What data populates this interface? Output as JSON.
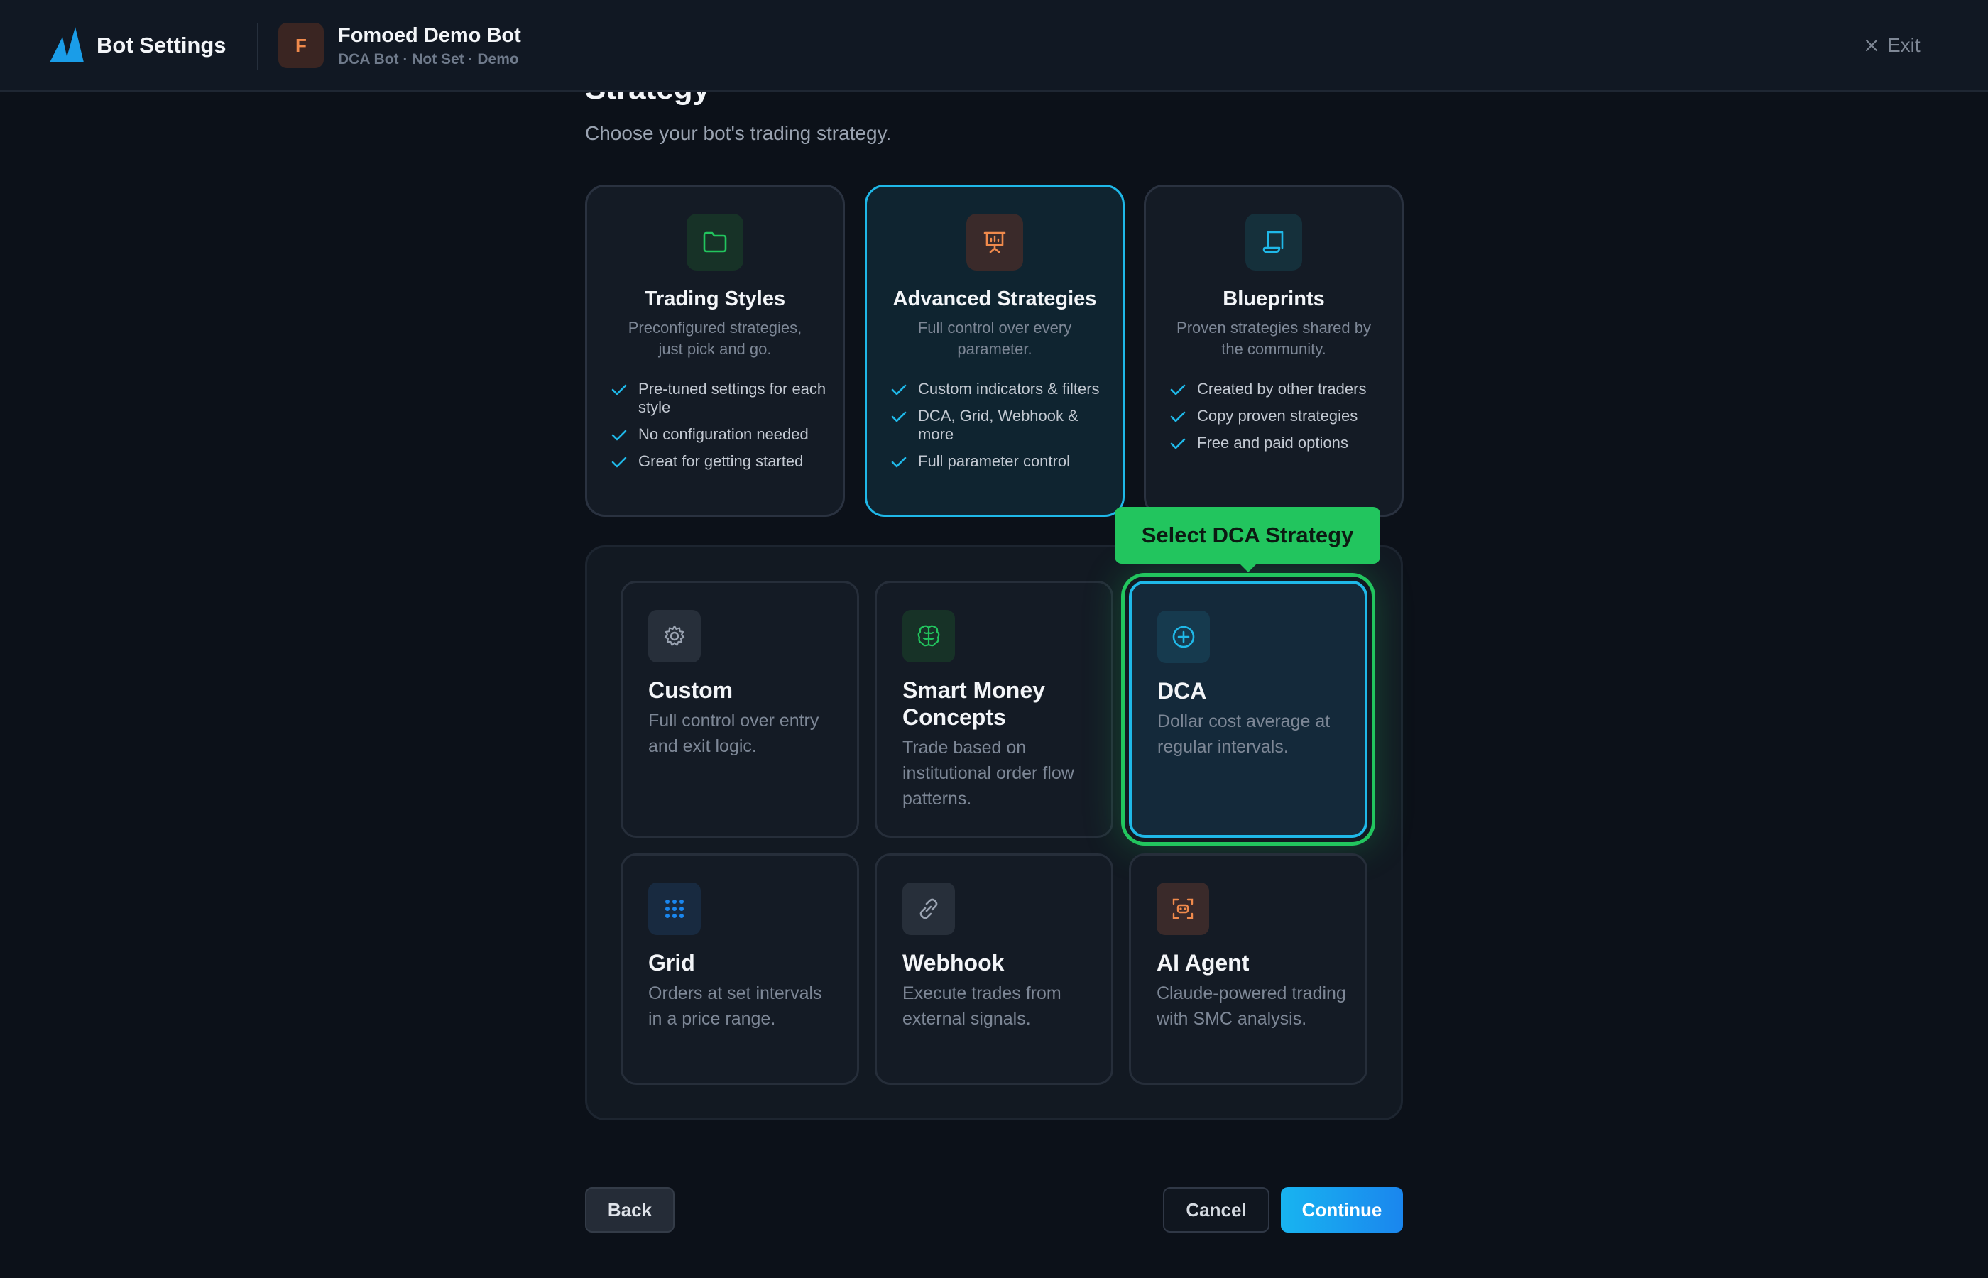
{
  "header": {
    "title": "Bot Settings",
    "bot_initial": "F",
    "bot_name": "Fomoed Demo Bot",
    "bot_meta": "DCA Bot · Not Set · Demo",
    "exit_label": "Exit"
  },
  "section": {
    "title": "Strategy",
    "subtitle": "Choose your bot's trading strategy."
  },
  "modes": [
    {
      "title": "Trading Styles",
      "desc": "Preconfigured strategies, just pick and go.",
      "features": [
        "Pre-tuned settings for each style",
        "No configuration needed",
        "Great for getting started"
      ]
    },
    {
      "title": "Advanced Strategies",
      "desc": "Full control over every parameter.",
      "features": [
        "Custom indicators & filters",
        "DCA, Grid, Webhook & more",
        "Full parameter control"
      ]
    },
    {
      "title": "Blueprints",
      "desc": "Proven strategies shared by the community.",
      "features": [
        "Created by other traders",
        "Copy proven strategies",
        "Free and paid options"
      ]
    }
  ],
  "strategies": [
    {
      "title": "Custom",
      "desc": "Full control over entry and exit logic."
    },
    {
      "title": "Smart Money Concepts",
      "desc": "Trade based on institutional order flow patterns."
    },
    {
      "title": "DCA",
      "desc": "Dollar cost average at regular intervals."
    },
    {
      "title": "Grid",
      "desc": "Orders at set intervals in a price range."
    },
    {
      "title": "Webhook",
      "desc": "Execute trades from external signals."
    },
    {
      "title": "AI Agent",
      "desc": "Claude-powered trading with SMC analysis."
    }
  ],
  "tooltip": "Select DCA Strategy",
  "footer": {
    "back": "Back",
    "cancel": "Cancel",
    "continue": "Continue"
  },
  "colors": {
    "accent": "#1fb8e8",
    "highlight": "#22c55e",
    "background": "#0c1119"
  }
}
